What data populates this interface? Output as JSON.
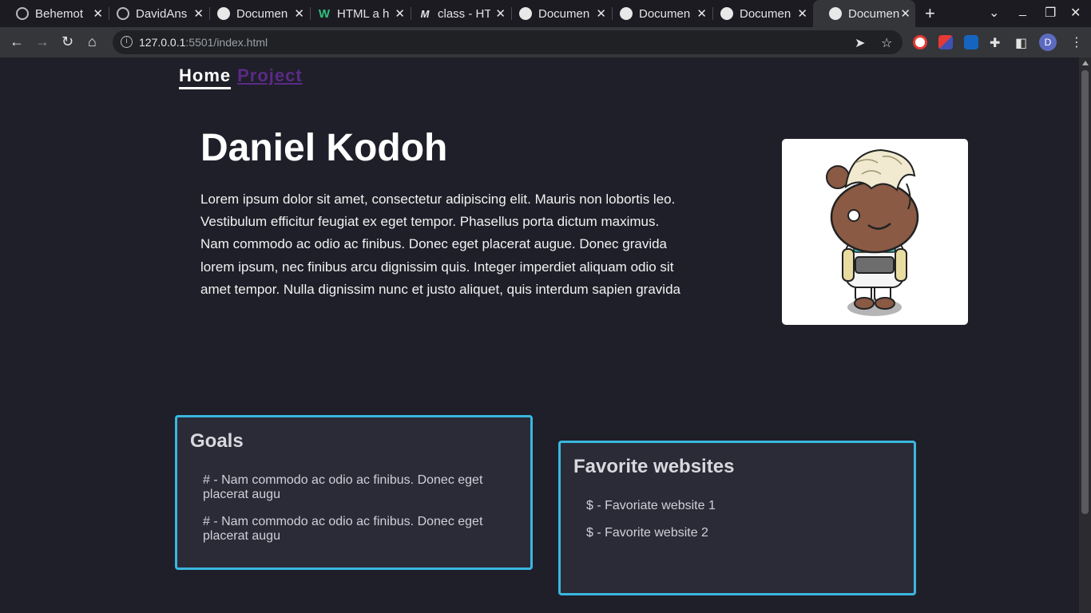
{
  "browser": {
    "tabs": [
      {
        "title": "Behemot",
        "icon": "github-icon"
      },
      {
        "title": "DavidAns",
        "icon": "github-icon"
      },
      {
        "title": "Documen",
        "icon": "globe-icon"
      },
      {
        "title": "HTML a h",
        "icon": "w3schools-icon"
      },
      {
        "title": "class - HT",
        "icon": "mdn-icon"
      },
      {
        "title": "Documen",
        "icon": "globe-icon"
      },
      {
        "title": "Documen",
        "icon": "globe-icon"
      },
      {
        "title": "Documen",
        "icon": "globe-icon"
      },
      {
        "title": "Documen",
        "icon": "globe-icon",
        "active": true
      }
    ],
    "url_host": "127.0.0.1",
    "url_rest": ":5501/index.html",
    "profile_initial": "D"
  },
  "nav": {
    "home": "Home",
    "project": "Project"
  },
  "hero": {
    "title": "Daniel Kodoh",
    "text": "Lorem ipsum dolor sit amet, consectetur adipiscing elit. Mauris non lobortis leo. Vestibulum efficitur feugiat ex eget tempor. Phasellus porta dictum maximus. Nam commodo ac odio ac finibus. Donec eget placerat augue. Donec gravida lorem ipsum, nec finibus arcu dignissim quis. Integer imperdiet aliquam odio sit amet tempor. Nulla dignissim nunc et justo aliquet, quis interdum sapien gravida"
  },
  "goals": {
    "title": "Goals",
    "items": [
      "# - Nam commodo ac odio ac finibus. Donec eget placerat augu",
      "# - Nam commodo ac odio ac finibus. Donec eget placerat augu"
    ]
  },
  "websites": {
    "title": "Favorite websites",
    "items": [
      "$ - Favoriate website 1",
      "$ - Favorite website 2"
    ]
  },
  "colors": {
    "page_bg": "#1f1f29",
    "card_bg": "#2b2b38",
    "card_border": "#3ab7e0",
    "project_link": "#5b2a86"
  }
}
